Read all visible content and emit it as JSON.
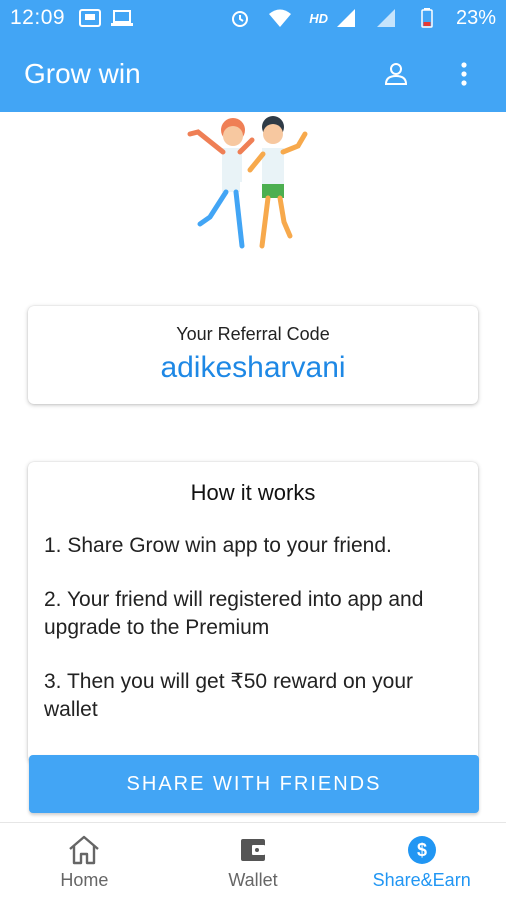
{
  "status_bar": {
    "time": "12:09",
    "hd_label": "HD",
    "battery": "23%"
  },
  "app_bar": {
    "title": "Grow win",
    "icons": [
      "account-icon",
      "more-vert-icon"
    ]
  },
  "referral": {
    "label": "Your Referral Code",
    "code": "adikesharvani"
  },
  "how_it_works": {
    "title": "How it works",
    "steps": [
      "1. Share Grow win app to your friend.",
      "2. Your friend will registered into app and upgrade to the Premium",
      "3. Then you will get ₹50 reward on your wallet"
    ]
  },
  "share_button": {
    "label": "SHARE WITH FRIENDS"
  },
  "bottom_nav": {
    "items": [
      {
        "label": "Home",
        "icon": "home-icon"
      },
      {
        "label": "Wallet",
        "icon": "wallet-icon"
      },
      {
        "label": "Share&Earn",
        "icon": "dollar-icon",
        "active": true
      }
    ]
  },
  "colors": {
    "primary": "#42a5f5",
    "accent": "#1e88e5",
    "nav_active": "#2196f3"
  }
}
